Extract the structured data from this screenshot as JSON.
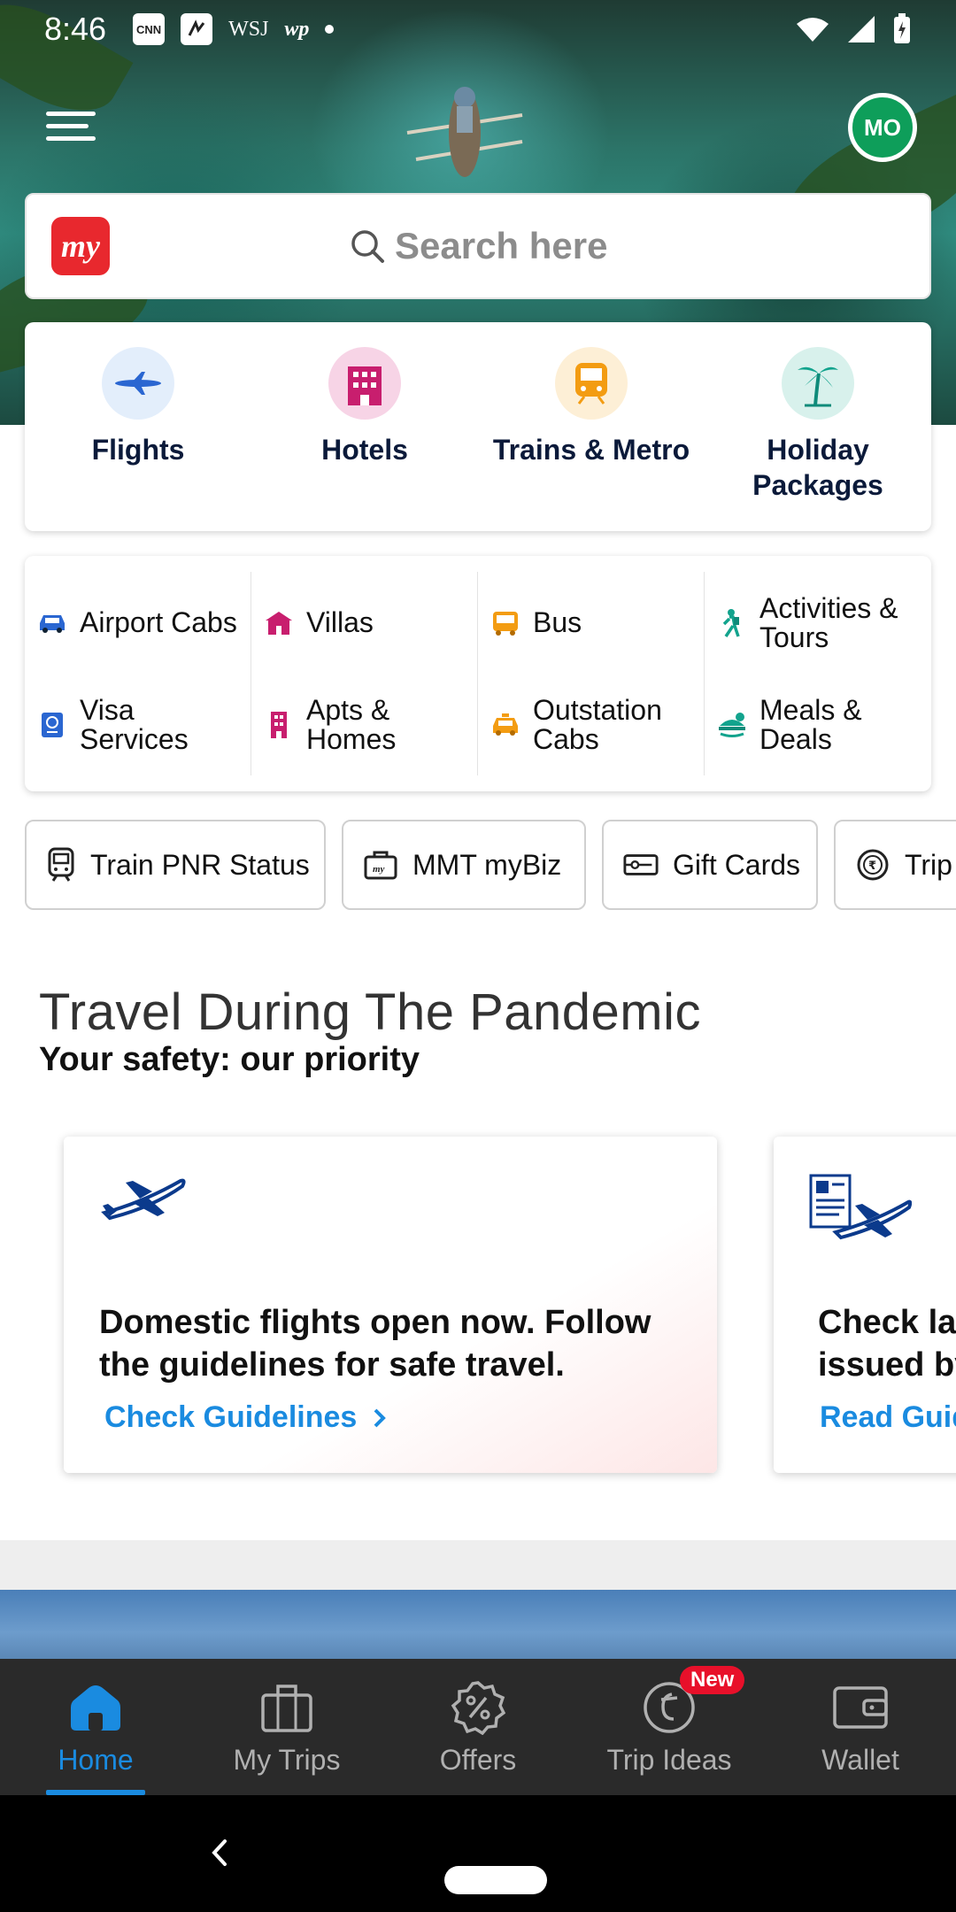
{
  "status_bar": {
    "time": "8:46",
    "notification_icons": [
      "cnn-icon",
      "app-icon",
      "wsj-icon",
      "wp-icon",
      "dot-icon"
    ],
    "cnn": "CNN",
    "wsj": "WSJ",
    "wp": "wp"
  },
  "header": {
    "avatar_initials": "MO",
    "logo_text": "my",
    "search_placeholder": "Search here"
  },
  "primary_categories": [
    {
      "label": "Flights",
      "icon": "airplane-icon"
    },
    {
      "label": "Hotels",
      "icon": "hotel-icon"
    },
    {
      "label": "Trains & Metro",
      "icon": "train-icon"
    },
    {
      "label": "Holiday Packages",
      "icon": "palm-tree-icon"
    }
  ],
  "secondary_categories": [
    {
      "label": "Airport Cabs",
      "icon": "car-icon"
    },
    {
      "label": "Villas",
      "icon": "villa-icon"
    },
    {
      "label": "Bus",
      "icon": "bus-icon"
    },
    {
      "label": "Activities & Tours",
      "icon": "hiker-icon"
    },
    {
      "label": "Visa Services",
      "icon": "passport-icon"
    },
    {
      "label": "Apts & Homes",
      "icon": "apartment-icon"
    },
    {
      "label": "Outstation Cabs",
      "icon": "taxi-icon"
    },
    {
      "label": "Meals & Deals",
      "icon": "meal-icon"
    }
  ],
  "chips": [
    {
      "label": "Train PNR Status",
      "icon": "train-icon"
    },
    {
      "label": "MMT myBiz",
      "icon": "briefcase-icon"
    },
    {
      "label": "Gift Cards",
      "icon": "gift-card-icon"
    },
    {
      "label": "Trip",
      "icon": "rupee-coin-icon"
    }
  ],
  "pandemic": {
    "title": "Travel During The Pandemic",
    "subtitle": "Your safety: our priority",
    "cards": [
      {
        "text": "Domestic flights open now. Follow the guidelines for safe travel.",
        "link": "Check Guidelines",
        "icon": "airplane-icon"
      },
      {
        "text_line1": "Check la",
        "text_line2": "issued by",
        "link": "Read Guid",
        "icon": "document-plane-icon"
      }
    ]
  },
  "bottom_nav": [
    {
      "label": "Home",
      "icon": "home-icon",
      "active": true
    },
    {
      "label": "My Trips",
      "icon": "suitcase-icon",
      "active": false
    },
    {
      "label": "Offers",
      "icon": "offer-badge-icon",
      "active": false
    },
    {
      "label": "Trip Ideas",
      "icon": "trip-ideas-icon",
      "active": false,
      "badge": "New"
    },
    {
      "label": "Wallet",
      "icon": "wallet-icon",
      "active": false
    }
  ],
  "colors": {
    "accent": "#1a8be0",
    "brand_red": "#e8282e",
    "avatar_green": "#0e9e5a",
    "nav_background": "#2a2a2a"
  }
}
